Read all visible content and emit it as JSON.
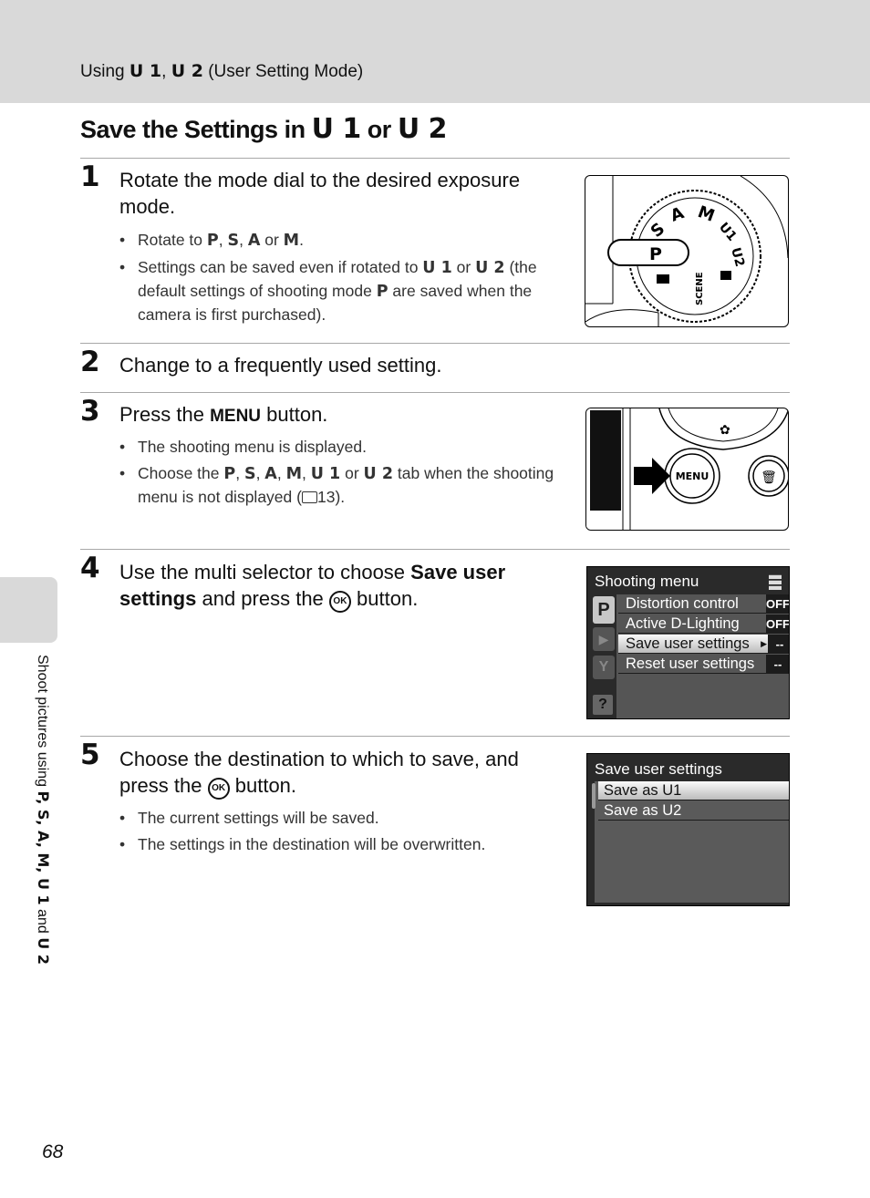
{
  "header": {
    "running_head_prefix": "Using",
    "running_head_u1": "U 1",
    "running_head_sep": ",",
    "running_head_u2": "U 2",
    "running_head_suffix": "(User Setting Mode)"
  },
  "title": {
    "prefix": "Save the Settings in",
    "u1": "U 1",
    "or": "or",
    "u2": "U 2"
  },
  "steps": [
    {
      "number": "1",
      "heading": "Rotate the mode dial to the desired exposure mode.",
      "bullets": [
        {
          "pre": "Rotate to",
          "p": "P",
          "s": "S",
          "a": "A",
          "or": "or",
          "m": "M",
          "end": "."
        },
        {
          "pre": "Settings can be saved even if rotated to",
          "u1": "U 1",
          "or": "or",
          "u2": "U 2",
          "mid": "(the default settings of shooting mode",
          "p": "P",
          "post": "are saved when the camera is first purchased)."
        }
      ],
      "figure": {
        "dial_labels": [
          "P",
          "S",
          "A",
          "M",
          "U1",
          "U2",
          "SCENE"
        ]
      }
    },
    {
      "number": "2",
      "heading": "Change to a frequently used setting."
    },
    {
      "number": "3",
      "heading_pre": "Press the",
      "heading_menu": "MENU",
      "heading_post": "button.",
      "bullets": [
        {
          "text": "The shooting menu is displayed."
        },
        {
          "pre": "Choose the",
          "p": "P",
          "s": "S",
          "a": "A",
          "m": "M",
          "u1": "U 1",
          "or": "or",
          "u2": "U 2",
          "post": "tab when the shooting menu is not displayed (",
          "ref": "13",
          "end": ")."
        }
      ],
      "figure": {
        "button_label": "MENU"
      }
    },
    {
      "number": "4",
      "heading_pre": "Use the multi selector to choose",
      "heading_bold": "Save user settings",
      "heading_mid": "and press the",
      "heading_ok": "OK",
      "heading_post": "button."
    },
    {
      "number": "5",
      "heading_pre": "Choose the destination to which to save, and press the",
      "heading_ok": "OK",
      "heading_post": "button.",
      "bullets": [
        {
          "text": "The current settings will be saved."
        },
        {
          "text": "The settings in the destination will be overwritten."
        }
      ]
    }
  ],
  "shooting_menu": {
    "title": "Shooting menu",
    "tabs": [
      "P",
      "▶",
      "Y",
      "?"
    ],
    "items": [
      {
        "label": "Distortion control",
        "value": "OFF"
      },
      {
        "label": "Active D-Lighting",
        "value": "OFF"
      },
      {
        "label": "Save user settings",
        "value": "--",
        "selected": true
      },
      {
        "label": "Reset user settings",
        "value": "--"
      }
    ]
  },
  "save_menu": {
    "title": "Save user settings",
    "items": [
      {
        "label": "Save as U1",
        "selected": true
      },
      {
        "label": "Save as U2"
      }
    ]
  },
  "side_tab": {
    "pre": "Shoot pictures using",
    "modes": "P, S, A, M, U 1",
    "and": "and",
    "last": "U 2"
  },
  "page_number": "68"
}
